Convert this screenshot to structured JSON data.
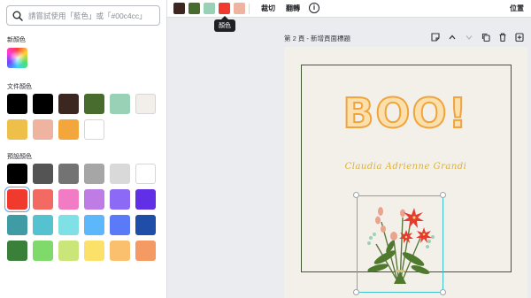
{
  "search": {
    "placeholder": "請嘗試使用「藍色」或「#00c4cc」"
  },
  "sections": {
    "new_color": "新顏色",
    "document_colors": "文件顏色",
    "default_colors": "預設顏色"
  },
  "document_colors": [
    "#000000",
    "#000000",
    "#3b2620",
    "#486b2e",
    "#98d1b6",
    "#f2eeea",
    "#eec04a",
    "#efb4a0",
    "#f3a63b",
    "#ffffff"
  ],
  "default_colors": [
    "#000000",
    "#545454",
    "#737373",
    "#a6a6a6",
    "#d9d9d9",
    "#ffffff",
    "#f03a2e",
    "#f36a63",
    "#f17cc4",
    "#c07ce5",
    "#8c6af5",
    "#6130e6",
    "#3f9ba4",
    "#55c3cf",
    "#7fe0e6",
    "#5cb8fb",
    "#5a7af8",
    "#1e4ea8",
    "#3a7f3a",
    "#80d96b",
    "#cae57a",
    "#fbe06a",
    "#fbc06e",
    "#f49a62"
  ],
  "selected_color": "#f03a2e",
  "toolbar": {
    "swatches": [
      "#3b2620",
      "#486b2e",
      "#98d1b6",
      "#f03a2e",
      "#efb4a0"
    ],
    "crop_label": "裁切",
    "flip_label": "翻轉",
    "info_label": "i",
    "position_label": "位置",
    "tooltip": "顏色"
  },
  "page": {
    "header": "第 2 頁 - 新增頁面標題",
    "title_text": "BOO!",
    "subtitle_text": "Claudia Adrienne Grandi"
  }
}
